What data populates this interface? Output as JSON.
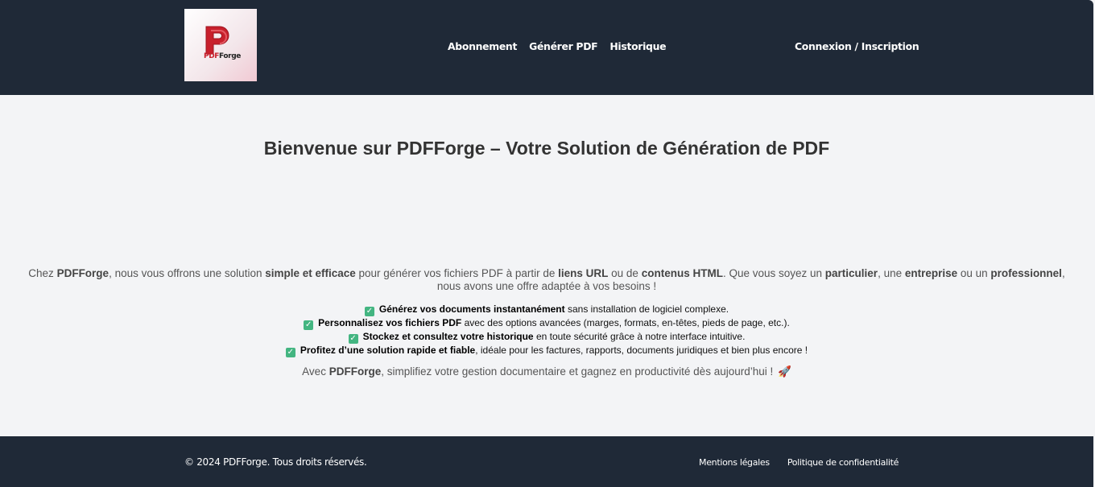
{
  "header": {
    "logo": {
      "text_pdf": "PDF",
      "text_forge": "Forge",
      "icon": "pdf-forge-logo-icon"
    },
    "nav": [
      {
        "label": "Abonnement"
      },
      {
        "label": "Générer PDF"
      },
      {
        "label": "Historique"
      }
    ],
    "auth_label": "Connexion / Inscription"
  },
  "main": {
    "title": "Bienvenue sur PDFForge – Votre Solution de Génération de PDF",
    "intro": {
      "t1": "Chez ",
      "b1": "PDFForge",
      "t2": ", nous vous offrons une solution ",
      "b2": "simple et efficace",
      "t3": " pour générer vos fichiers PDF à partir de ",
      "b3": "liens URL",
      "t4": " ou de ",
      "b4": "contenus HTML",
      "t5": ". Que vous soyez un ",
      "b5": "particulier",
      "t6": ", une ",
      "b6": "entreprise",
      "t7": " ou un ",
      "b7": "professionnel",
      "t8": ", nous avons une offre adaptée à vos besoins !"
    },
    "features": [
      {
        "bold": "Générez vos documents instantanément",
        "rest": " sans installation de logiciel complexe."
      },
      {
        "bold": "Personnalisez vos fichiers PDF",
        "rest": " avec des options avancées (marges, formats, en-têtes, pieds de page, etc.)."
      },
      {
        "bold": "Stockez et consultez votre historique",
        "rest": " en toute sécurité grâce à notre interface intuitive."
      },
      {
        "bold": "Profitez d’une solution rapide et fiable",
        "rest": ", idéale pour les factures, rapports, documents juridiques et bien plus encore !"
      }
    ],
    "check_icon": "check-mark-icon",
    "closing": {
      "t1": "Avec ",
      "b1": "PDFForge",
      "t2": ", simplifiez votre gestion documentaire et gagnez en productivité dès aujourd’hui ! ",
      "emoji": "🚀"
    }
  },
  "footer": {
    "copyright": "© 2024 PDFForge. Tous droits réservés.",
    "links": [
      {
        "label": "Mentions légales"
      },
      {
        "label": "Politique de confidentialité"
      }
    ]
  },
  "colors": {
    "header_bg": "#1f2937",
    "page_bg": "#f3f4f6",
    "check_green": "#43b581",
    "logo_red": "#c8202c"
  }
}
